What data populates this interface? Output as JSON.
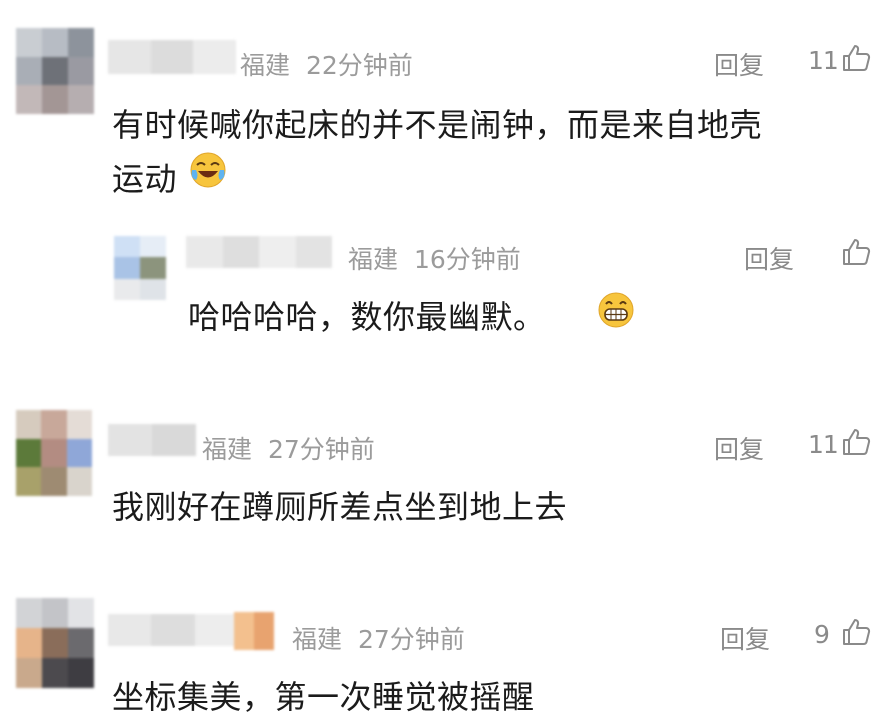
{
  "comments": [
    {
      "location": "福建",
      "time": "22分钟前",
      "text_line1": "有时候喊你起床的并不是闹钟，而是来自地壳",
      "text_line2": "运动",
      "emoji": "crying-laughing-emoji",
      "reply_label": "回复",
      "likes": "11"
    },
    {
      "location": "福建",
      "time": "16分钟前",
      "text": "哈哈哈哈，数你最幽默。",
      "emoji": "grinning-emoji",
      "reply_label": "回复",
      "likes": ""
    },
    {
      "location": "福建",
      "time": "27分钟前",
      "text": "我刚好在蹲厕所差点坐到地上去",
      "reply_label": "回复",
      "likes": "11"
    },
    {
      "location": "福建",
      "time": "27分钟前",
      "text": "坐标集美，第一次睡觉被摇醒",
      "reply_label": "回复",
      "likes": "9"
    }
  ],
  "icons": {
    "like": "thumbs-up-icon"
  }
}
